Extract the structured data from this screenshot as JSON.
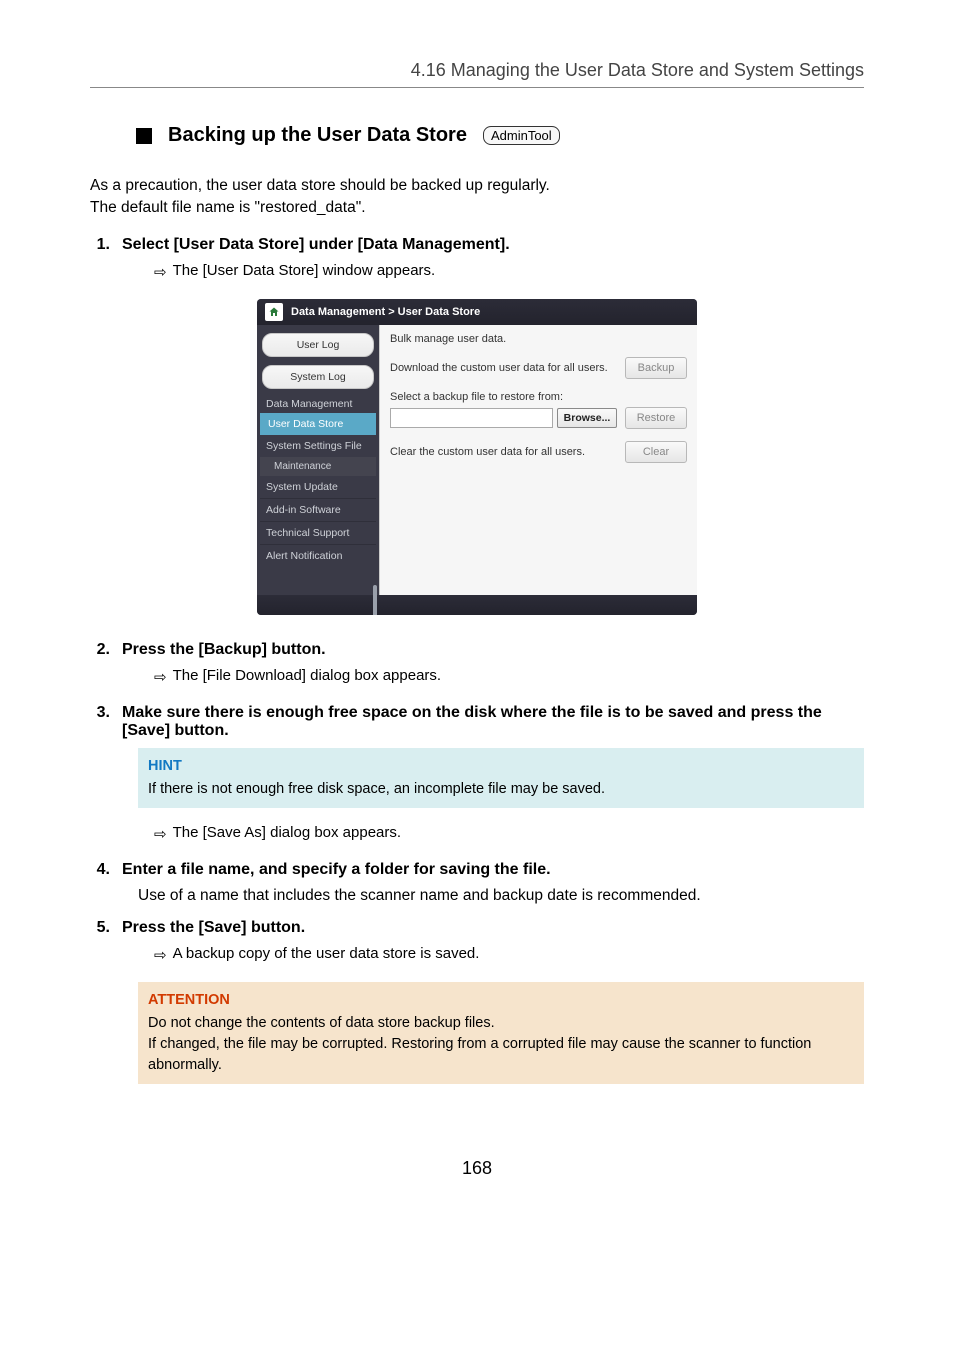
{
  "header": "4.16 Managing the User Data Store and System Settings",
  "section": {
    "title": "Backing up the User Data Store",
    "badge": "AdminTool"
  },
  "intro_line1": "As a precaution, the user data store should be backed up regularly.",
  "intro_line2": "The default file name is \"restored_data\".",
  "steps": {
    "s1": {
      "num": "1.",
      "text": "Select [User Data Store] under [Data Management]."
    },
    "s1_sub": "The [User Data Store] window appears.",
    "s2": {
      "num": "2.",
      "text": "Press the [Backup] button."
    },
    "s2_sub": "The [File Download] dialog box appears.",
    "s3": {
      "num": "3.",
      "text": "Make sure there is enough free space on the disk where the file is to be saved and press the [Save] button."
    },
    "s3_sub_after": "The [Save As] dialog box appears.",
    "s4": {
      "num": "4.",
      "text": "Enter a file name, and specify a folder for saving the file."
    },
    "s4_note": "Use of a name that includes the scanner name and backup date is recommended.",
    "s5": {
      "num": "5.",
      "text": "Press the [Save] button."
    },
    "s5_sub": "A backup copy of the user data store is saved."
  },
  "hint": {
    "label": "HINT",
    "text": "If there is not enough free disk space, an incomplete file may be saved."
  },
  "attention": {
    "label": "ATTENTION",
    "line1": "Do not change the contents of data store backup files.",
    "line2": "If changed, the file may be corrupted. Restoring from a corrupted file may cause the scanner to function abnormally."
  },
  "ui": {
    "breadcrumb": "Data Management > User Data Store",
    "side": {
      "user_log": "User Log",
      "system_log": "System Log",
      "cat_data_mgmt": "Data Management",
      "active": "User Data Store",
      "sys_settings": "System Settings File",
      "maintenance": "Maintenance",
      "sys_update": "System Update",
      "addin": "Add-in Software",
      "tech": "Technical Support",
      "alert": "Alert Notification"
    },
    "main": {
      "bulk": "Bulk manage user data.",
      "download": "Download the custom user data for all users.",
      "select_restore": "Select a backup file to restore from:",
      "clear": "Clear the custom user data for all users.",
      "btn_backup": "Backup",
      "btn_restore": "Restore",
      "btn_browse": "Browse...",
      "btn_clear": "Clear"
    }
  },
  "page_number": "168",
  "arrow_glyph": "⇨"
}
